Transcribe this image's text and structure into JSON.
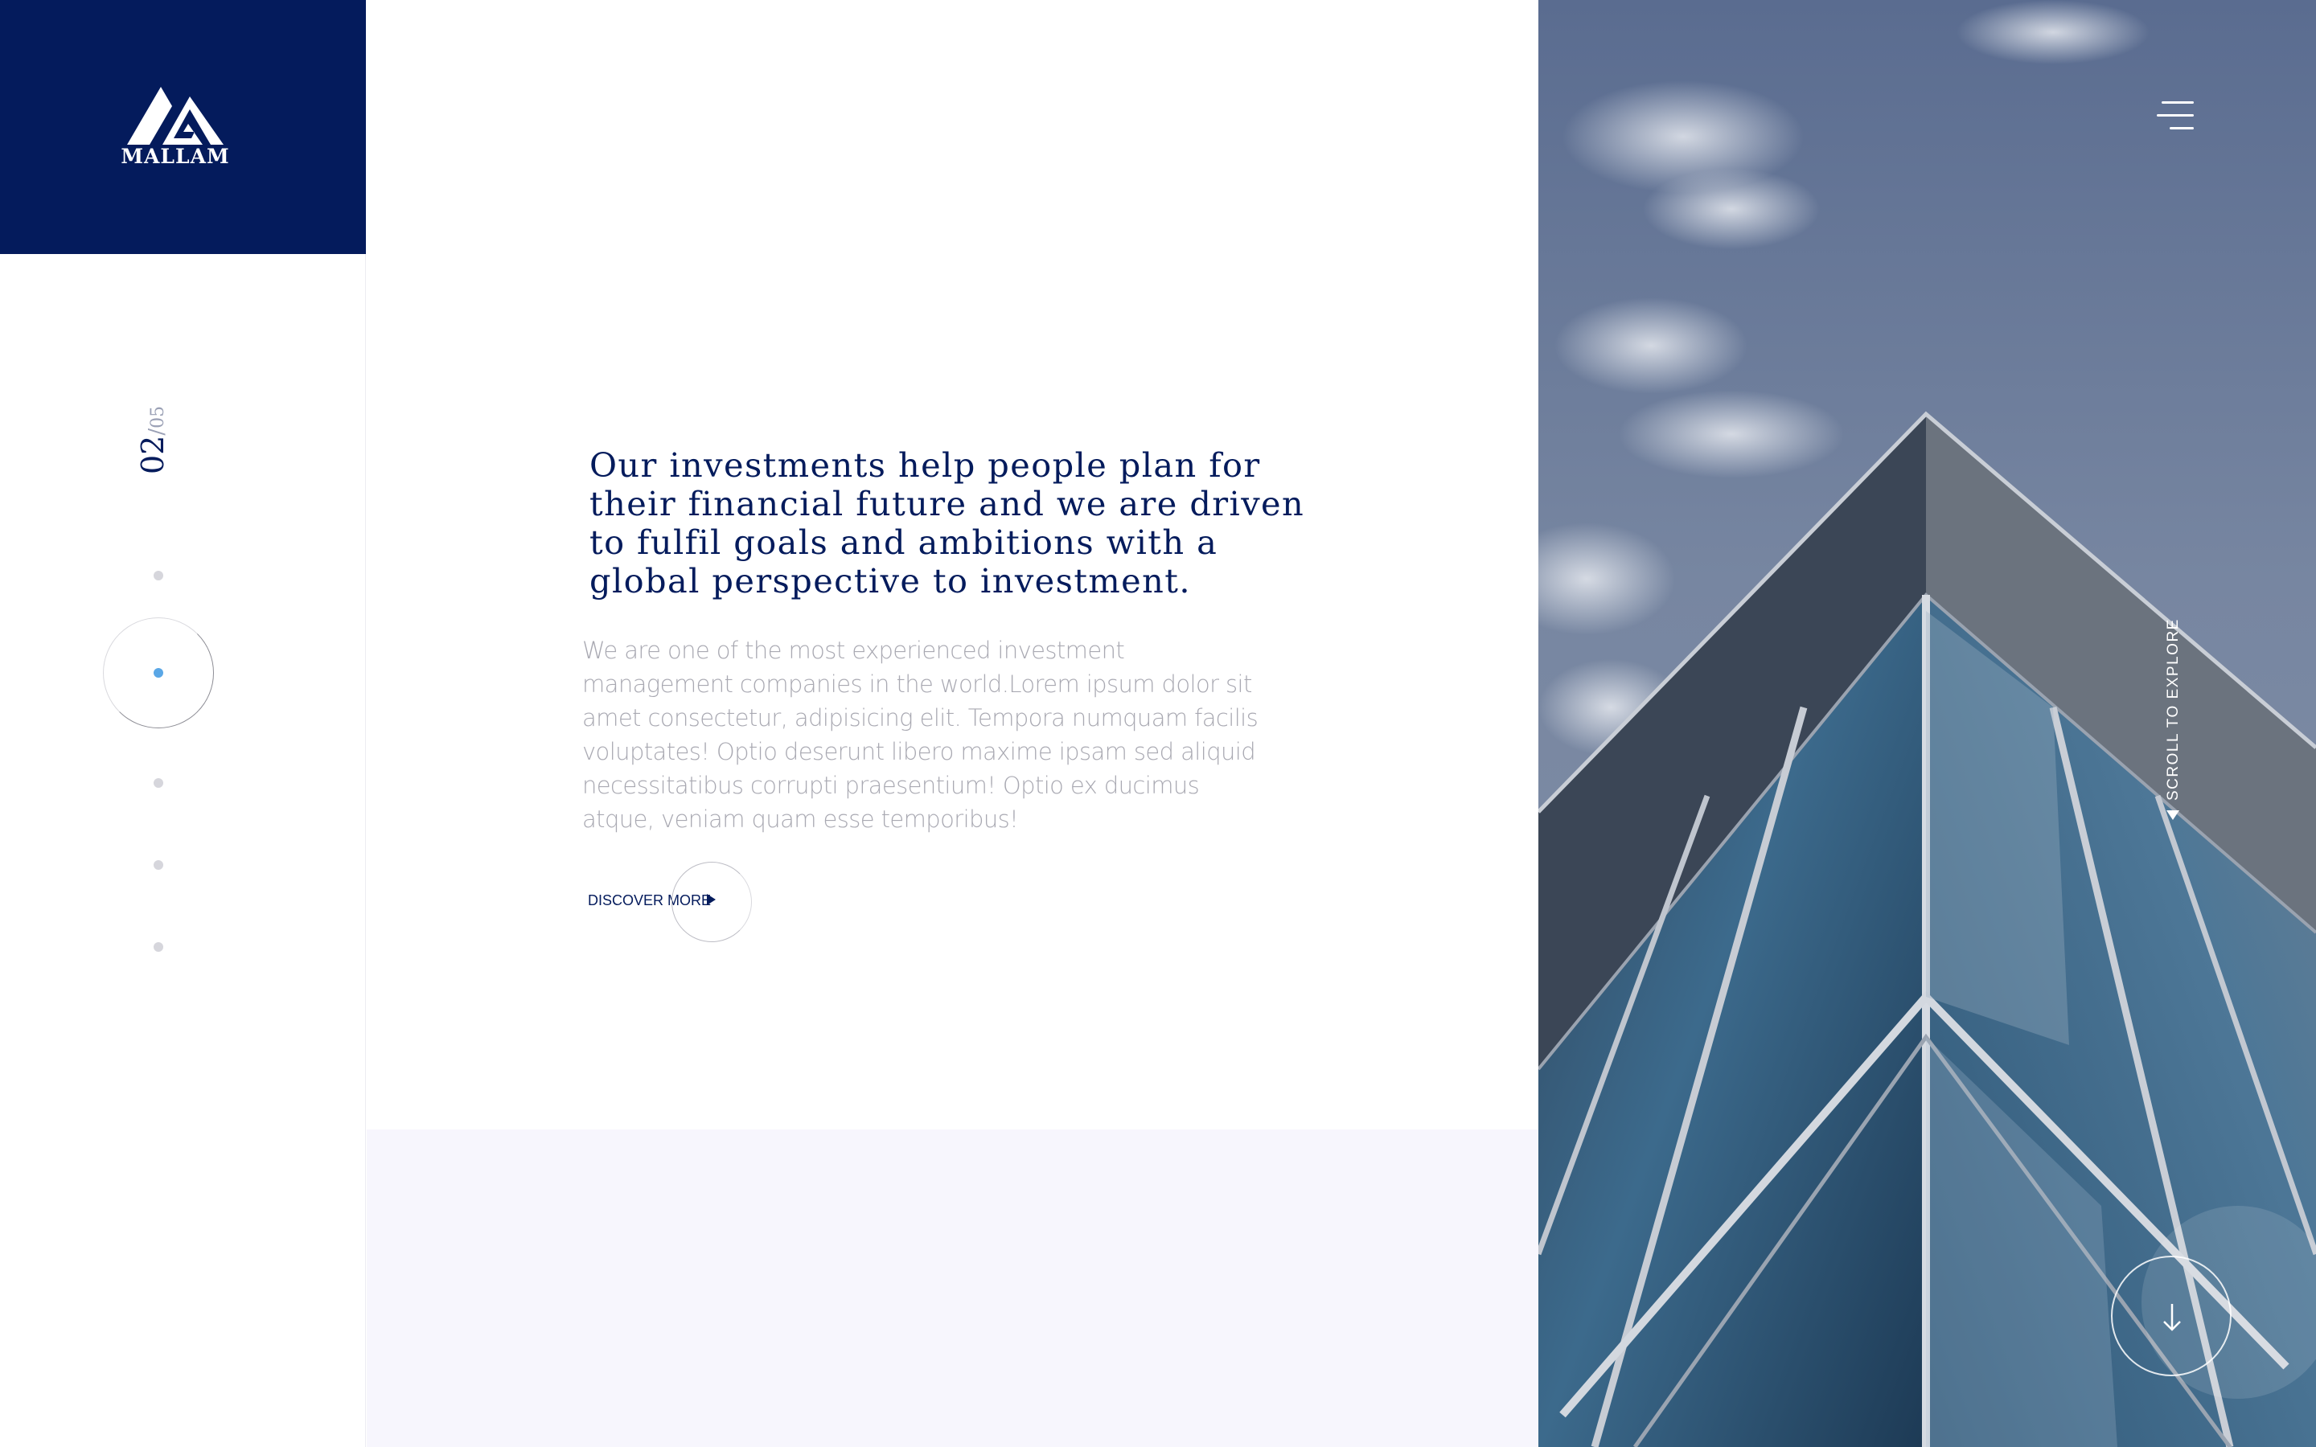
{
  "brand": {
    "name": "MALLAM",
    "logo_color": "#041b5c"
  },
  "slide_counter": {
    "current": "02",
    "separator": "/",
    "total": "05"
  },
  "pagination": {
    "count": 5,
    "active_index": 1,
    "active_color": "#5aa7e6"
  },
  "content": {
    "headline": "Our investments help people plan for their financial future and we are driven to fulfil goals and ambitions with a global perspective to investment.",
    "body": "We are one of the most experienced investment management companies in the world.Lorem ipsum dolor sit amet consectetur, adipisicing elit. Tempora numquam facilis voluptates! Optio deserunt libero maxime ipsam sed aliquid necessitatibus corrupti praesentium! Optio ex ducimus atque, veniam quam esse temporibus!",
    "cta_label": "DISCOVER MORE"
  },
  "hero": {
    "menu_icon": "hamburger-menu-icon",
    "scroll_hint": "SCROLL  TO  EXPLORE",
    "scroll_down_icon": "arrow-down-icon"
  },
  "colors": {
    "navy": "#041b5c",
    "text_grey": "#a9a9b2",
    "lower_bg": "#f7f6fd"
  }
}
